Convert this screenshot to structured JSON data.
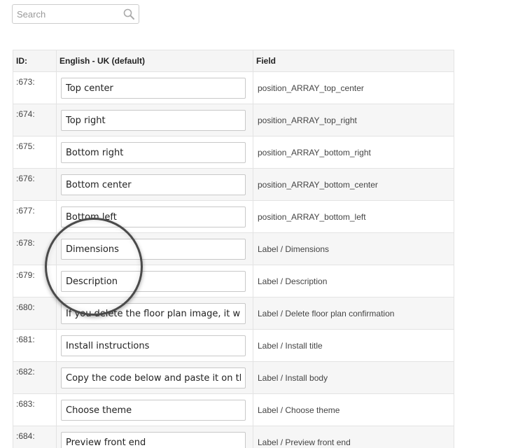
{
  "search": {
    "placeholder": "Search",
    "value": ""
  },
  "table": {
    "headers": {
      "id": "ID:",
      "text": "English - UK (default)",
      "field": "Field"
    },
    "rows": [
      {
        "id": ":673:",
        "value": "Top center",
        "field": "position_ARRAY_top_center"
      },
      {
        "id": ":674:",
        "value": "Top right",
        "field": "position_ARRAY_top_right"
      },
      {
        "id": ":675:",
        "value": "Bottom right",
        "field": "position_ARRAY_bottom_right"
      },
      {
        "id": ":676:",
        "value": "Bottom center",
        "field": "position_ARRAY_bottom_center"
      },
      {
        "id": ":677:",
        "value": "Bottom left",
        "field": "position_ARRAY_bottom_left"
      },
      {
        "id": ":678:",
        "value": "Dimensions",
        "field": "Label / Dimensions"
      },
      {
        "id": ":679:",
        "value": "Description",
        "field": "Label / Description"
      },
      {
        "id": ":680:",
        "value": "If you delete the floor plan image, it will",
        "field": "Label / Delete floor plan confirmation"
      },
      {
        "id": ":681:",
        "value": "Install instructions",
        "field": "Label / Install title"
      },
      {
        "id": ":682:",
        "value": "Copy the code below and paste it on th",
        "field": "Label / Install body"
      },
      {
        "id": ":683:",
        "value": "Choose theme",
        "field": "Label / Choose theme"
      },
      {
        "id": ":684:",
        "value": "Preview front end",
        "field": "Label / Preview front end"
      }
    ]
  },
  "icons": {
    "search": "search-icon"
  },
  "colors": {
    "header_bg": "#f5f5f5",
    "row_alt_bg": "#f6f6f6",
    "border": "#e3e3e3",
    "lens_ring": "#4a4a4a"
  }
}
